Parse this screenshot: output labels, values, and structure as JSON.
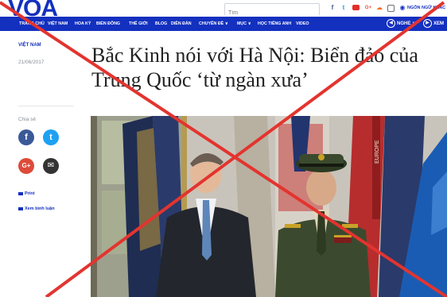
{
  "header": {
    "logo": "VOA",
    "search_placeholder": "Tìm",
    "language_label": "NGÔN NGỮ KHÁC"
  },
  "nav": {
    "items": [
      "TRANG CHỦ",
      "VIỆT NAM",
      "HOA KỲ",
      "BIỂN ĐÔNG",
      "THẾ GIỚI",
      "BLOG",
      "DIỄN ĐÀN",
      "CHUYÊN ĐỀ ∨",
      "MỤC ∨",
      "HỌC TIẾNG ANH",
      "VIDEO"
    ],
    "listen_label": "NGHE ∨",
    "watch_label": "XEM"
  },
  "article": {
    "category": "VIỆT NAM",
    "date": "21/06/2017",
    "headline_line1": "Bắc Kinh nói với Hà Nội: Biển đảo của",
    "headline_line2": "Trung Quốc ‘từ ngàn xưa’"
  },
  "share": {
    "label": "Chia sẻ",
    "buttons": [
      {
        "name": "facebook",
        "glyph": "f",
        "color": "#3b5998"
      },
      {
        "name": "twitter",
        "glyph": "t",
        "color": "#1da1f2"
      },
      {
        "name": "googleplus",
        "glyph": "G+",
        "color": "#dd4b39"
      },
      {
        "name": "email",
        "glyph": "✉",
        "color": "#333333"
      }
    ],
    "print_label": "Print",
    "comments_label": "Xem bình luận"
  },
  "photo": {
    "flag_label": "EUROPE"
  },
  "overlay": {
    "cross_color": "#e3342f"
  }
}
